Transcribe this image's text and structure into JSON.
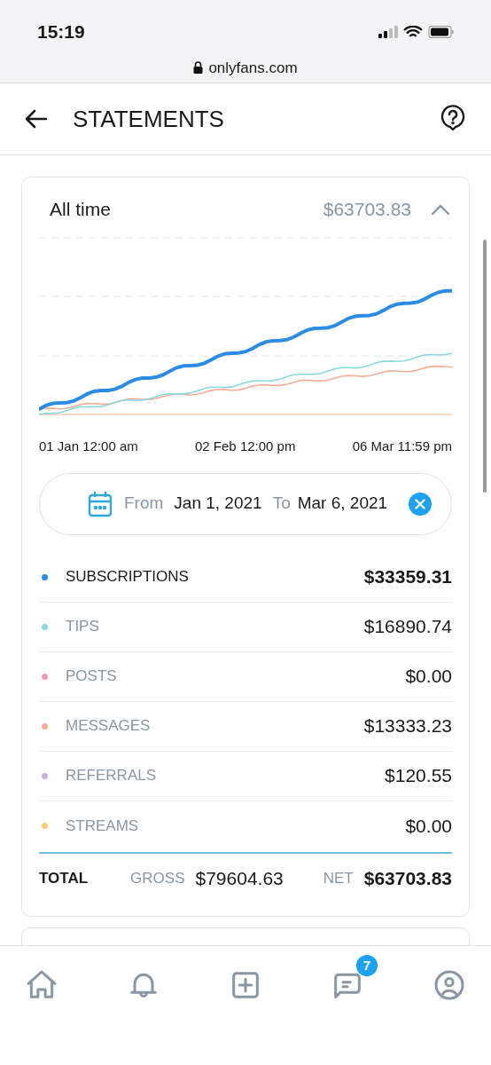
{
  "status_bar": {
    "time": "15:19"
  },
  "browser": {
    "url": "onlyfans.com"
  },
  "header": {
    "title": "STATEMENTS"
  },
  "summary": {
    "period": "All time",
    "amount": "$63703.83",
    "expanded": true,
    "chart_axis_labels": [
      "01 Jan 12:00 am",
      "02 Feb 12:00 pm",
      "06 Mar 11:59 pm"
    ],
    "date_range": {
      "from_label": "From",
      "from": "Jan 1, 2021",
      "to_label": "To",
      "to": "Mar 6, 2021"
    },
    "categories": [
      {
        "name": "SUBSCRIPTIONS",
        "amount": "$33359.31",
        "color": "#2b8ce6",
        "selected": true
      },
      {
        "name": "TIPS",
        "amount": "$16890.74",
        "color": "#8ad9e3",
        "selected": false
      },
      {
        "name": "POSTS",
        "amount": "$0.00",
        "color": "#ef9ab0",
        "selected": false
      },
      {
        "name": "MESSAGES",
        "amount": "$13333.23",
        "color": "#f5ad93",
        "selected": false
      },
      {
        "name": "REFERRALS",
        "amount": "$120.55",
        "color": "#c6aee0",
        "selected": false
      },
      {
        "name": "STREAMS",
        "amount": "$0.00",
        "color": "#f9cc7a",
        "selected": false
      }
    ],
    "total": {
      "label": "TOTAL",
      "gross_label": "GROSS",
      "gross": "$79604.63",
      "net_label": "NET",
      "net": "$63703.83"
    }
  },
  "bottom_nav": [
    {
      "kind": "home"
    },
    {
      "kind": "notifications"
    },
    {
      "kind": "add"
    },
    {
      "kind": "messages",
      "badge": "7"
    },
    {
      "kind": "profile"
    }
  ]
}
